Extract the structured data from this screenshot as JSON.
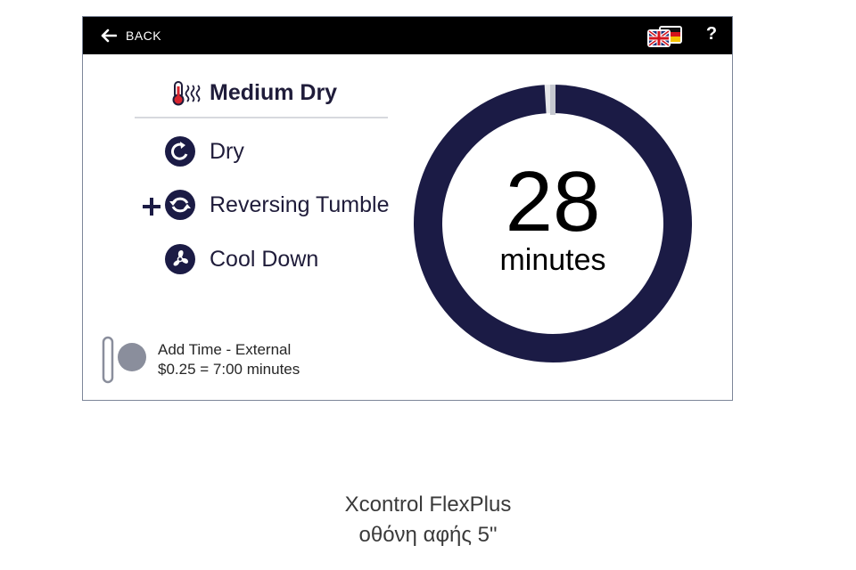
{
  "topbar": {
    "back_label": "BACK",
    "help_label": "?",
    "language_icon": "uk-germany-flags-icon"
  },
  "cycle": {
    "title": "Medium Dry",
    "title_icon": "heat-temperature-icon",
    "steps": [
      {
        "label": "Dry",
        "icon": "dry-rotate-icon"
      },
      {
        "label": "Reversing Tumble",
        "icon": "reversing-tumble-icon",
        "addon": "plus-icon"
      },
      {
        "label": "Cool Down",
        "icon": "cool-down-fan-icon"
      }
    ]
  },
  "timer": {
    "value": "28",
    "unit": "minutes",
    "remaining_fraction": 0.99,
    "ring_color": "#1b1b45",
    "marker_color": "#c5c8cf"
  },
  "add_time": {
    "line1": "Add Time - External",
    "line2": "$0.25 = 7:00 minutes",
    "toggle_on": false
  },
  "caption": {
    "line1": "Xcontrol FlexPlus",
    "line2": "οθόνη αφής 5\""
  },
  "colors": {
    "topbar": "#000000",
    "primary_text": "#1f1c3a",
    "accent": "#1b1b45"
  }
}
